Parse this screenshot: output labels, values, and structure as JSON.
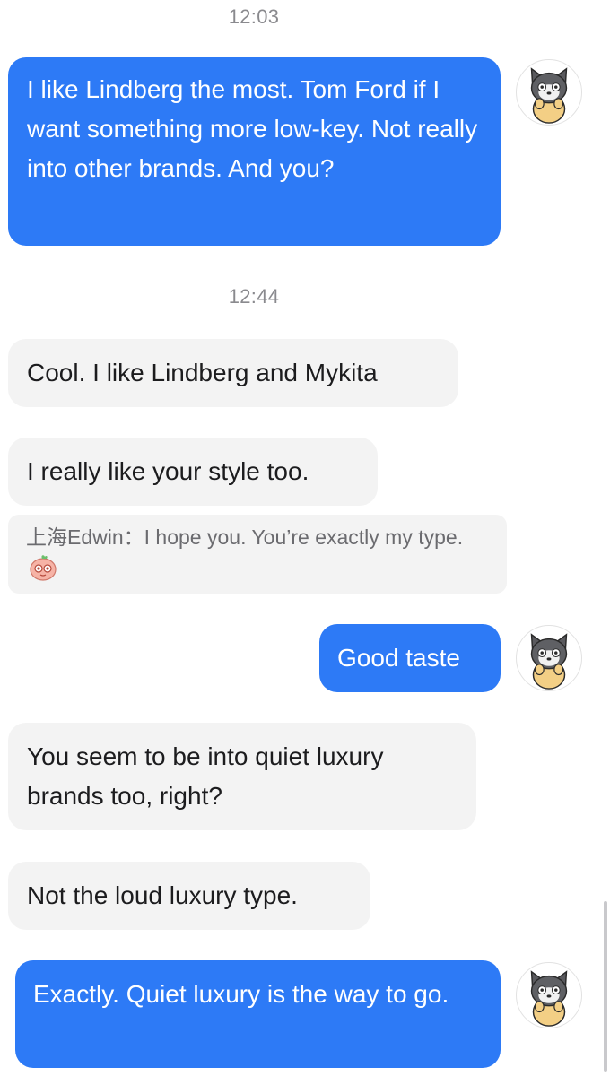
{
  "messages": [
    {
      "kind": "timestamp",
      "text": "12:03"
    },
    {
      "kind": "sent",
      "text": "I like Lindberg the most. Tom Ford if I want something more low-key. Not really into other brands. And you?"
    },
    {
      "kind": "timestamp",
      "text": "12:44"
    },
    {
      "kind": "received",
      "text": "Cool. I like Lindberg and Mykita"
    },
    {
      "kind": "received",
      "text": "I really like your style too."
    },
    {
      "kind": "quote",
      "sender": "上海Edwin：",
      "text": "I hope you. You’re exactly my type.",
      "emoji": "peach-face-emoji"
    },
    {
      "kind": "sent",
      "text": "Good taste"
    },
    {
      "kind": "received",
      "text": "You seem to be into quiet luxury brands too, right?"
    },
    {
      "kind": "received",
      "text": "Not the loud luxury type."
    },
    {
      "kind": "sent",
      "text": "Exactly. Quiet luxury is the way to go."
    }
  ],
  "avatar": {
    "icon": "raccoon-cat-avatar-icon"
  },
  "colors": {
    "sent_bubble": "#2d7af6",
    "received_bubble": "#f3f3f3",
    "timestamp": "#8a8a8e"
  }
}
